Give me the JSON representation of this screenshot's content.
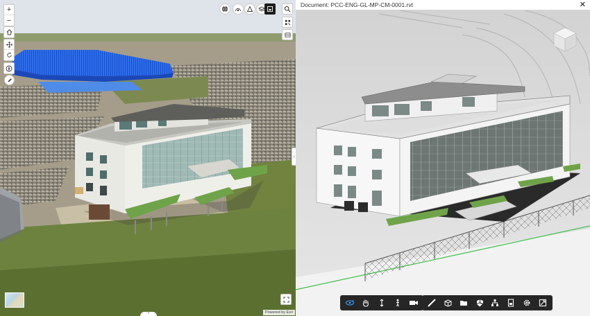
{
  "document": {
    "title": "Document: PCC-ENG-GL-MP-CM-0001.rvt",
    "close_symbol": "✕"
  },
  "scene": {
    "attribution": "Powered by Esri",
    "zoom_in_symbol": "+",
    "zoom_out_symbol": "−",
    "expand_symbol": "›",
    "collapse_symbol": "⌃"
  },
  "colors": {
    "toolbar_bg": "#262626",
    "active_tool": "#3aa0ff",
    "roof_blue": "#1e63e0",
    "green_deck": "#6fa34a"
  },
  "left_nav_tools": [
    "zoom-in",
    "zoom-out",
    "home",
    "pan",
    "rotate",
    "compass",
    "edit"
  ],
  "top_scene_tools": [
    "basemap-gallery",
    "daylight",
    "line-of-sight",
    "layer-list",
    "esri-dark-toggle",
    "search"
  ],
  "right_scene_tools": [
    "qr-code",
    "collapse-panel"
  ],
  "viewer_tool_groups": [
    [
      "orbit",
      "pan",
      "zoom",
      "first-person",
      "camera"
    ],
    [
      "measure",
      "section-box",
      "explode",
      "model-browser"
    ],
    [
      "model-structure",
      "document-browser",
      "settings",
      "fullscreen"
    ]
  ]
}
